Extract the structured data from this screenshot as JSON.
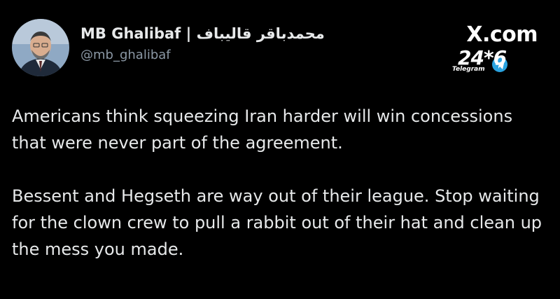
{
  "author": {
    "display_name": "MB Ghalibaf | محمدباقر قالیباف",
    "handle": "@mb_ghalibaf",
    "avatar_icon": "person-portrait-icon"
  },
  "branding": {
    "site": "X.com",
    "logo_text": "24*6",
    "logo_subtext": "Telegram",
    "logo_icon": "telegram-plane-icon"
  },
  "tweet": {
    "paragraphs": [
      "Americans think squeezing Iran harder will win concessions that were never part of the agreement.",
      "Bessent and Hegseth are way out of their league. Stop waiting for the clown crew to pull a rabbit out of their hat and clean up the mess you made."
    ]
  },
  "colors": {
    "background": "#000000",
    "text": "#e7e9ea",
    "muted": "#8b98a5",
    "accent_blue": "#2aa3e0"
  }
}
